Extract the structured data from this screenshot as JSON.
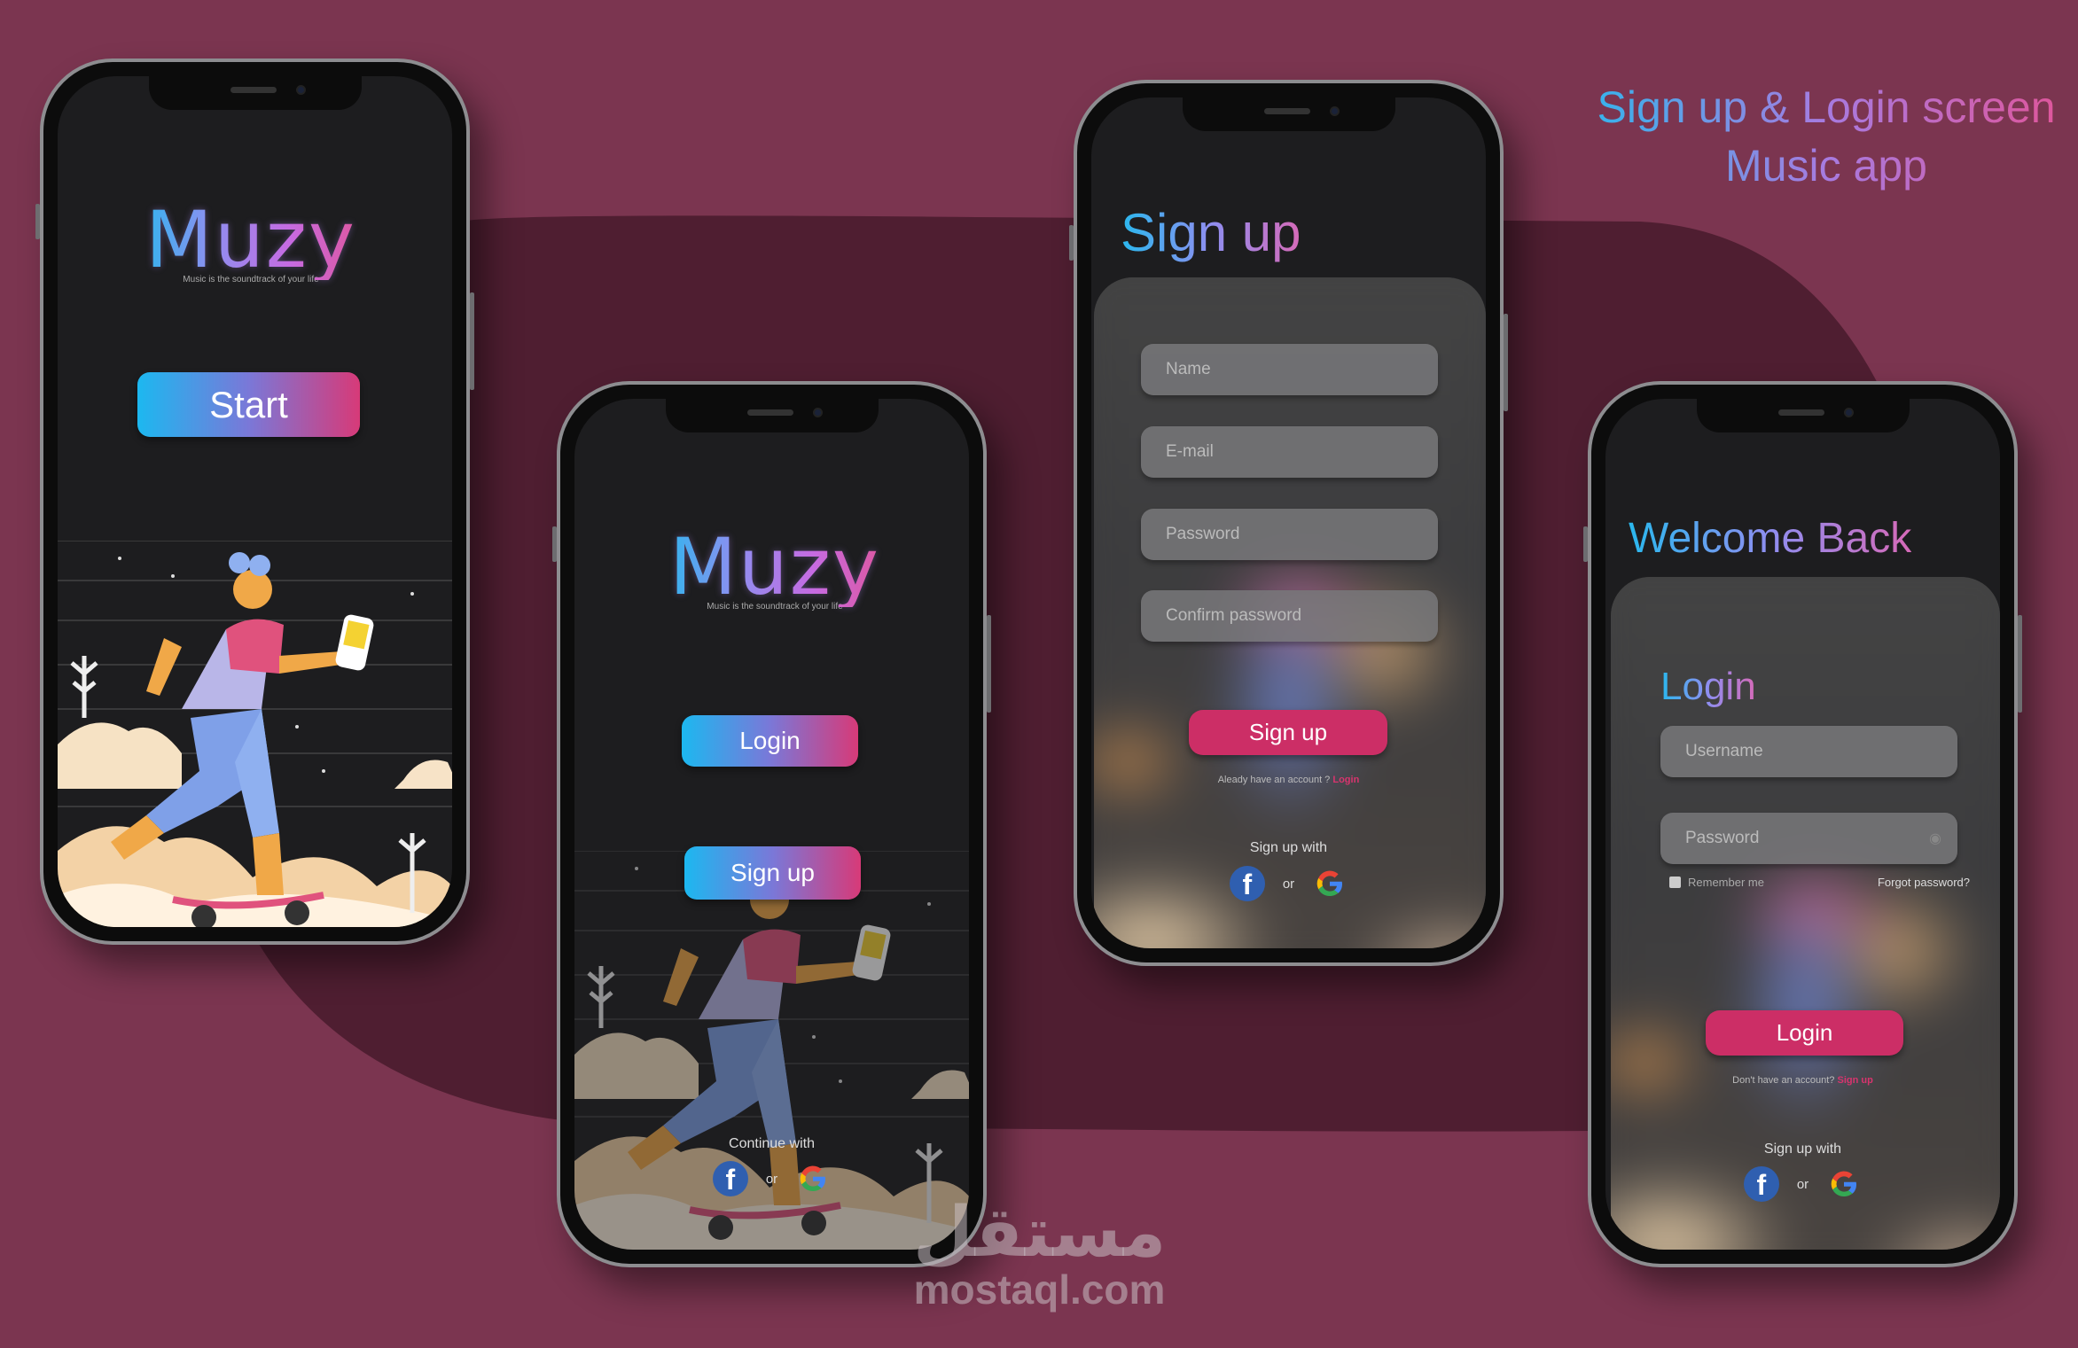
{
  "heading": {
    "line1": "Sign up & Login screen",
    "line2": "Music app"
  },
  "colors": {
    "background": "#7b3550",
    "accent_pink": "#cc2e66",
    "gradient_blue": "#1cb8f0",
    "gradient_pink": "#d73a78"
  },
  "splash": {
    "logo": "Muzy",
    "tagline": "Music is the soundtrack of your life",
    "start_button": "Start"
  },
  "welcome": {
    "logo": "Muzy",
    "tagline": "Music is the soundtrack of your life",
    "login_button": "Login",
    "signup_button": "Sign up",
    "continue_with": "Continue with",
    "or": "or",
    "icons": [
      "facebook-icon",
      "google-icon"
    ]
  },
  "signup": {
    "title": "Sign up",
    "fields": [
      {
        "placeholder": "Name"
      },
      {
        "placeholder": "E-mail"
      },
      {
        "placeholder": "Password"
      },
      {
        "placeholder": "Confirm password"
      }
    ],
    "submit": "Sign up",
    "have_account": "Aleady have an account ?",
    "login_link": "Login",
    "signup_with": "Sign up with",
    "or": "or"
  },
  "login": {
    "title": "Welcome Back",
    "subtitle": "Login",
    "fields": [
      {
        "placeholder": "Username"
      },
      {
        "placeholder": "Password"
      }
    ],
    "remember_me": "Remember me",
    "remember_checked": false,
    "forgot": "Forgot password?",
    "submit": "Login",
    "no_account": "Don't have an account?",
    "signup_link": "Sign up",
    "signup_with": "Sign up with",
    "or": "or"
  },
  "watermark": {
    "arabic": "مستقل",
    "latin": "mostaql.com"
  }
}
